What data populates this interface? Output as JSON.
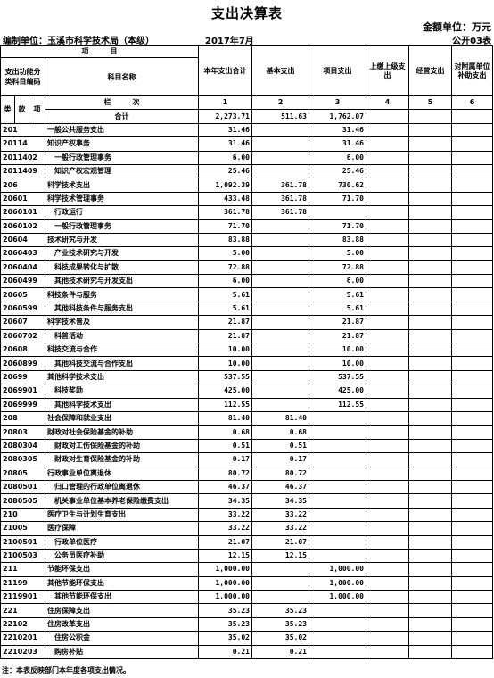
{
  "title": "支出决算表",
  "unit_label": "金额单位：万元",
  "org_label": "编制单位：玉溪市科学技术局（本级）",
  "date_label": "2017年7月",
  "code_label": "公开03表",
  "header": {
    "item": "项　　　目",
    "func_code": "支出功能分类科目编码",
    "subject_name": "科目名称",
    "total": "本年支出合计",
    "basic": "基本支出",
    "project": "项目支出",
    "handover": "上缴上级支出",
    "business": "经营支出",
    "subsidy": "对附属单位补助支出",
    "lei": "类",
    "kuan": "款",
    "xiang": "项",
    "lanci": "栏　　　次",
    "col1": "1",
    "col2": "2",
    "col3": "3",
    "col4": "4",
    "col5": "5",
    "col6": "6"
  },
  "rows": [
    {
      "code": "",
      "name": "合计",
      "total": "2,273.71",
      "basic": "511.63",
      "project": "1,762.07",
      "level": 0
    },
    {
      "code": "201",
      "name": "一般公共服务支出",
      "total": "31.46",
      "basic": "",
      "project": "31.46",
      "level": 0
    },
    {
      "code": "20114",
      "name": "知识产权事务",
      "total": "31.46",
      "basic": "",
      "project": "31.46",
      "level": 0
    },
    {
      "code": "2011402",
      "name": "一般行政管理事务",
      "total": "6.00",
      "basic": "",
      "project": "6.00",
      "level": 1
    },
    {
      "code": "2011409",
      "name": "知识产权宏观管理",
      "total": "25.46",
      "basic": "",
      "project": "25.46",
      "level": 1
    },
    {
      "code": "206",
      "name": "科学技术支出",
      "total": "1,092.39",
      "basic": "361.78",
      "project": "730.62",
      "level": 0
    },
    {
      "code": "20601",
      "name": "科学技术管理事务",
      "total": "433.48",
      "basic": "361.78",
      "project": "71.70",
      "level": 0
    },
    {
      "code": "2060101",
      "name": "行政运行",
      "total": "361.78",
      "basic": "361.78",
      "project": "",
      "level": 1
    },
    {
      "code": "2060102",
      "name": "一般行政管理事务",
      "total": "71.70",
      "basic": "",
      "project": "71.70",
      "level": 1
    },
    {
      "code": "20604",
      "name": "技术研究与开发",
      "total": "83.88",
      "basic": "",
      "project": "83.88",
      "level": 0
    },
    {
      "code": "2060403",
      "name": "产业技术研究与开发",
      "total": "5.00",
      "basic": "",
      "project": "5.00",
      "level": 1
    },
    {
      "code": "2060404",
      "name": "科技成果转化与扩散",
      "total": "72.88",
      "basic": "",
      "project": "72.88",
      "level": 1
    },
    {
      "code": "2060499",
      "name": "其他技术研究与开发支出",
      "total": "6.00",
      "basic": "",
      "project": "6.00",
      "level": 1
    },
    {
      "code": "20605",
      "name": "科技条件与服务",
      "total": "5.61",
      "basic": "",
      "project": "5.61",
      "level": 0
    },
    {
      "code": "2060599",
      "name": "其他科技条件与服务支出",
      "total": "5.61",
      "basic": "",
      "project": "5.61",
      "level": 1
    },
    {
      "code": "20607",
      "name": "科学技术普及",
      "total": "21.87",
      "basic": "",
      "project": "21.87",
      "level": 0
    },
    {
      "code": "2060702",
      "name": "科普活动",
      "total": "21.87",
      "basic": "",
      "project": "21.87",
      "level": 1
    },
    {
      "code": "20608",
      "name": "科技交流与合作",
      "total": "10.00",
      "basic": "",
      "project": "10.00",
      "level": 0
    },
    {
      "code": "2060899",
      "name": "其他科技交流与合作支出",
      "total": "10.00",
      "basic": "",
      "project": "10.00",
      "level": 1
    },
    {
      "code": "20699",
      "name": "其他科学技术支出",
      "total": "537.55",
      "basic": "",
      "project": "537.55",
      "level": 0
    },
    {
      "code": "2069901",
      "name": "科技奖励",
      "total": "425.00",
      "basic": "",
      "project": "425.00",
      "level": 1
    },
    {
      "code": "2069999",
      "name": "其他科学技术支出",
      "total": "112.55",
      "basic": "",
      "project": "112.55",
      "level": 1
    },
    {
      "code": "208",
      "name": "社会保障和就业支出",
      "total": "81.40",
      "basic": "81.40",
      "project": "",
      "level": 0
    },
    {
      "code": "20803",
      "name": "财政对社会保险基金的补助",
      "total": "0.68",
      "basic": "0.68",
      "project": "",
      "level": 0
    },
    {
      "code": "2080304",
      "name": "财政对工伤保险基金的补助",
      "total": "0.51",
      "basic": "0.51",
      "project": "",
      "level": 1
    },
    {
      "code": "2080305",
      "name": "财政对生育保险基金的补助",
      "total": "0.17",
      "basic": "0.17",
      "project": "",
      "level": 1
    },
    {
      "code": "20805",
      "name": "行政事业单位离退休",
      "total": "80.72",
      "basic": "80.72",
      "project": "",
      "level": 0
    },
    {
      "code": "2080501",
      "name": "归口管理的行政单位离退休",
      "total": "46.37",
      "basic": "46.37",
      "project": "",
      "level": 1
    },
    {
      "code": "2080505",
      "name": "机关事业单位基本养老保险缴费支出",
      "total": "34.35",
      "basic": "34.35",
      "project": "",
      "level": 1
    },
    {
      "code": "210",
      "name": "医疗卫生与计划生育支出",
      "total": "33.22",
      "basic": "33.22",
      "project": "",
      "level": 0
    },
    {
      "code": "21005",
      "name": "医疗保障",
      "total": "33.22",
      "basic": "33.22",
      "project": "",
      "level": 0
    },
    {
      "code": "2100501",
      "name": "行政单位医疗",
      "total": "21.07",
      "basic": "21.07",
      "project": "",
      "level": 1
    },
    {
      "code": "2100503",
      "name": "公务员医疗补助",
      "total": "12.15",
      "basic": "12.15",
      "project": "",
      "level": 1
    },
    {
      "code": "211",
      "name": "节能环保支出",
      "total": "1,000.00",
      "basic": "",
      "project": "1,000.00",
      "level": 0
    },
    {
      "code": "21199",
      "name": "其他节能环保支出",
      "total": "1,000.00",
      "basic": "",
      "project": "1,000.00",
      "level": 0
    },
    {
      "code": "2119901",
      "name": "其他节能环保支出",
      "total": "1,000.00",
      "basic": "",
      "project": "1,000.00",
      "level": 1
    },
    {
      "code": "221",
      "name": "住房保障支出",
      "total": "35.23",
      "basic": "35.23",
      "project": "",
      "level": 0
    },
    {
      "code": "22102",
      "name": "住房改革支出",
      "total": "35.23",
      "basic": "35.23",
      "project": "",
      "level": 0
    },
    {
      "code": "2210201",
      "name": "住房公积金",
      "total": "35.02",
      "basic": "35.02",
      "project": "",
      "level": 1
    },
    {
      "code": "2210203",
      "name": "购房补贴",
      "total": "0.21",
      "basic": "0.21",
      "project": "",
      "level": 1
    }
  ],
  "footnote": "注：本表反映部门本年度各项支出情况。"
}
